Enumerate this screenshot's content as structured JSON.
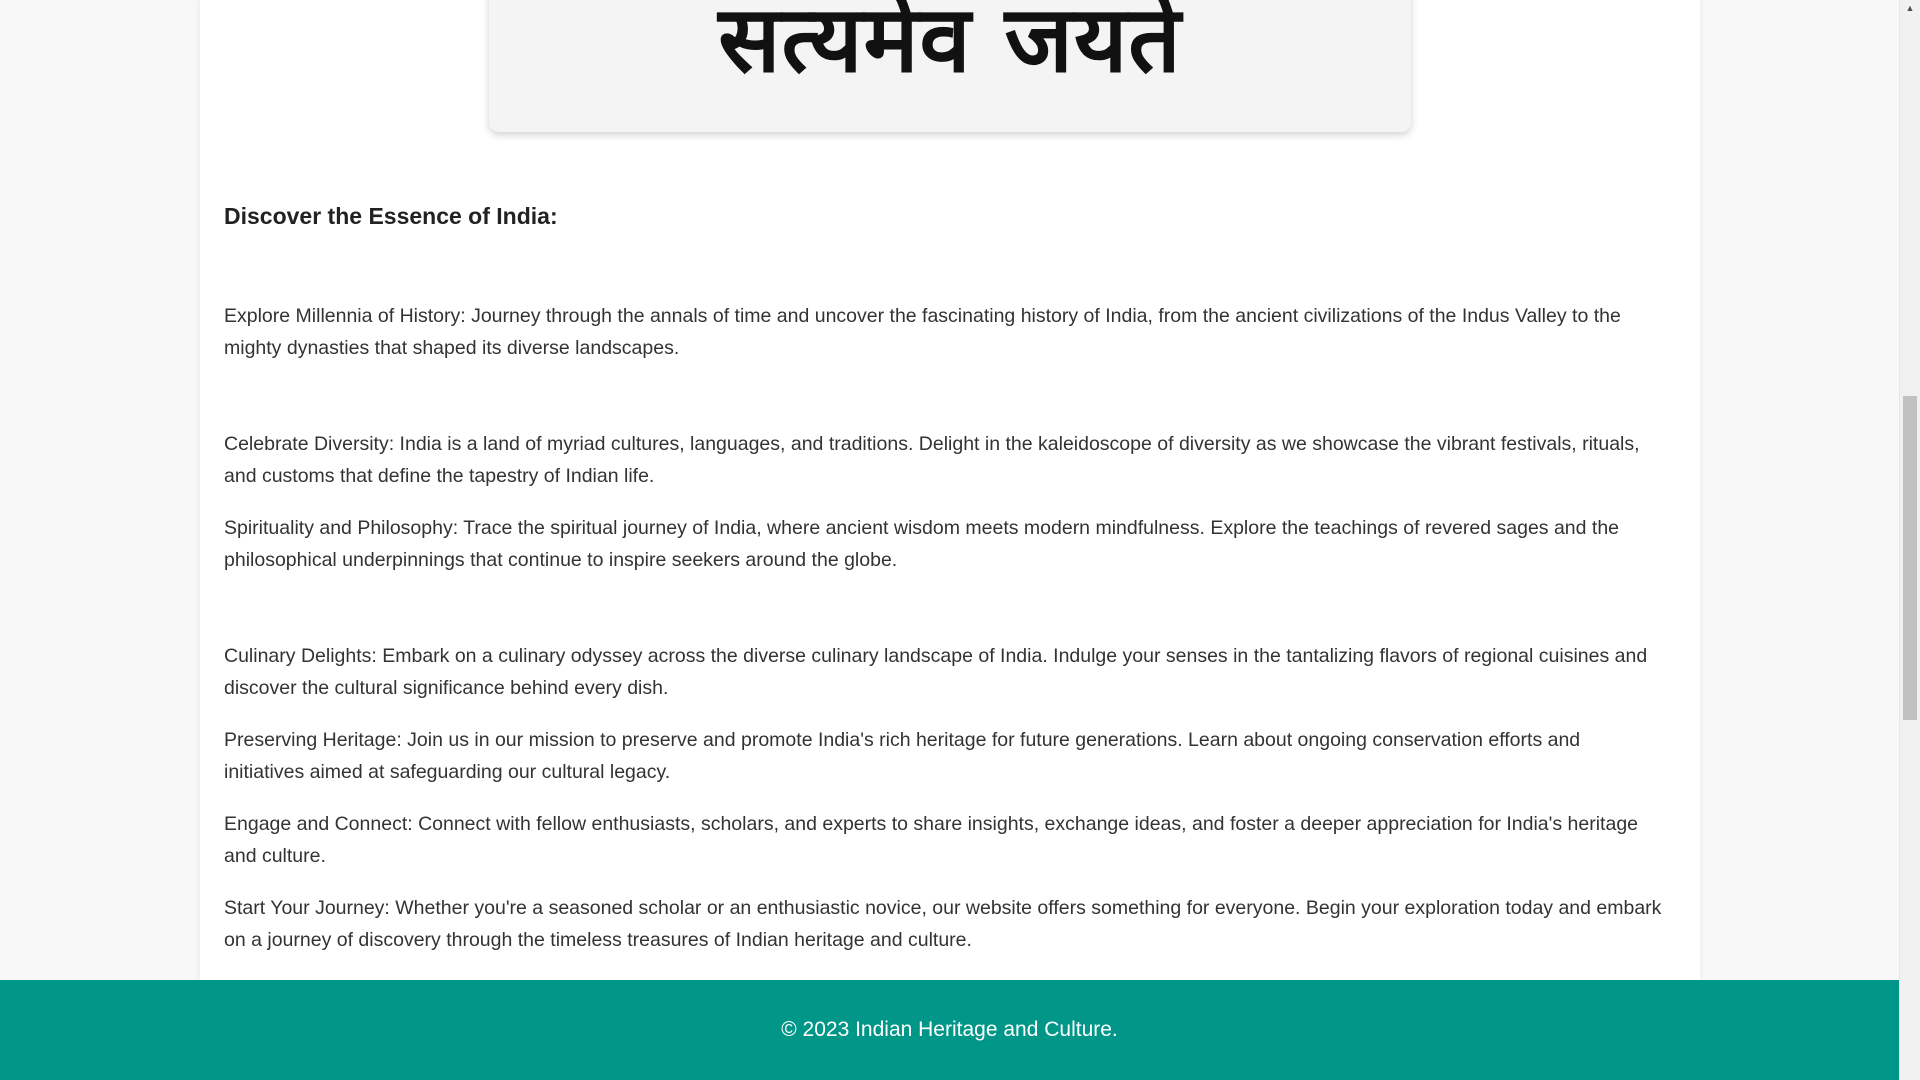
{
  "motto": {
    "text": "सत्यमेव जयते"
  },
  "main": {
    "heading": "Discover the Essence of India:",
    "paragraphs": [
      "Explore Millennia of History: Journey through the annals of time and uncover the fascinating history of India, from the ancient civilizations of the Indus Valley to the mighty dynasties that shaped its diverse landscapes.",
      "Celebrate Diversity: India is a land of myriad cultures, languages, and traditions. Delight in the kaleidoscope of diversity as we showcase the vibrant festivals, rituals, and customs that define the tapestry of Indian life.",
      "Spirituality and Philosophy: Trace the spiritual journey of India, where ancient wisdom meets modern mindfulness. Explore the teachings of revered sages and the philosophical underpinnings that continue to inspire seekers around the globe.",
      "Culinary Delights: Embark on a culinary odyssey across the diverse culinary landscape of India. Indulge your senses in the tantalizing flavors of regional cuisines and discover the cultural significance behind every dish.",
      "Preserving Heritage: Join us in our mission to preserve and promote India's rich heritage for future generations. Learn about ongoing conservation efforts and initiatives aimed at safeguarding our cultural legacy.",
      "Engage and Connect: Connect with fellow enthusiasts, scholars, and experts to share insights, exchange ideas, and foster a deeper appreciation for India's heritage and culture.",
      "Start Your Journey: Whether you're a seasoned scholar or an enthusiastic novice, our website offers something for everyone. Begin your exploration today and embark on a journey of discovery through the timeless treasures of Indian heritage and culture."
    ]
  },
  "footer": {
    "text": "© 2023 Indian Heritage and Culture."
  },
  "colors": {
    "footer_bg": "#009688",
    "page_bg": "#f8f8f8",
    "card_bg": "#ffffff"
  },
  "icons": {
    "scroll_up": "scroll-up-arrow-icon"
  }
}
